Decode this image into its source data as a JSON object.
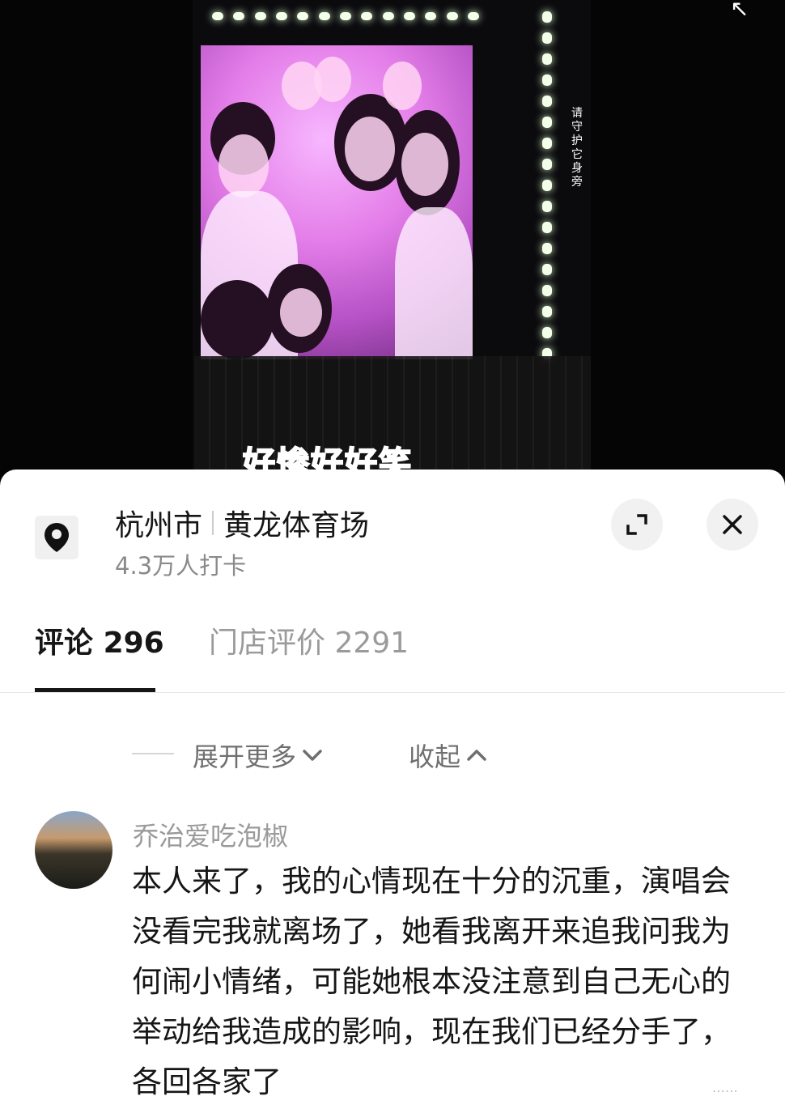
{
  "video": {
    "screen_vertical_text": "请守护它身旁",
    "caption": "好惨好好笑"
  },
  "location": {
    "icon": "location-pin-icon",
    "city": "杭州市",
    "venue": "黄龙体育场",
    "checkins": "4.3万人打卡"
  },
  "actions": {
    "expand_icon": "expand-icon",
    "close_icon": "close-icon"
  },
  "tabs": [
    {
      "label": "评论",
      "count": "296",
      "active": true
    },
    {
      "label": "门店评价",
      "count": "2291",
      "active": false
    }
  ],
  "thread": {
    "expand_more_label": "展开更多",
    "collapse_label": "收起"
  },
  "comment": {
    "username": "乔治爱吃泡椒",
    "text": "本人来了，我的心情现在十分的沉重，演唱会没看完我就离场了，她看我离开来追我问我为何闹小情绪，可能她根本没注意到自己无心的举动给我造成的影响，现在我们已经分手了，各回各家了"
  },
  "colors": {
    "sheet_bg": "#ffffff",
    "primary_text": "#161616",
    "secondary_text": "#8a8a8a",
    "caption_pink": "#ff5aa0"
  }
}
